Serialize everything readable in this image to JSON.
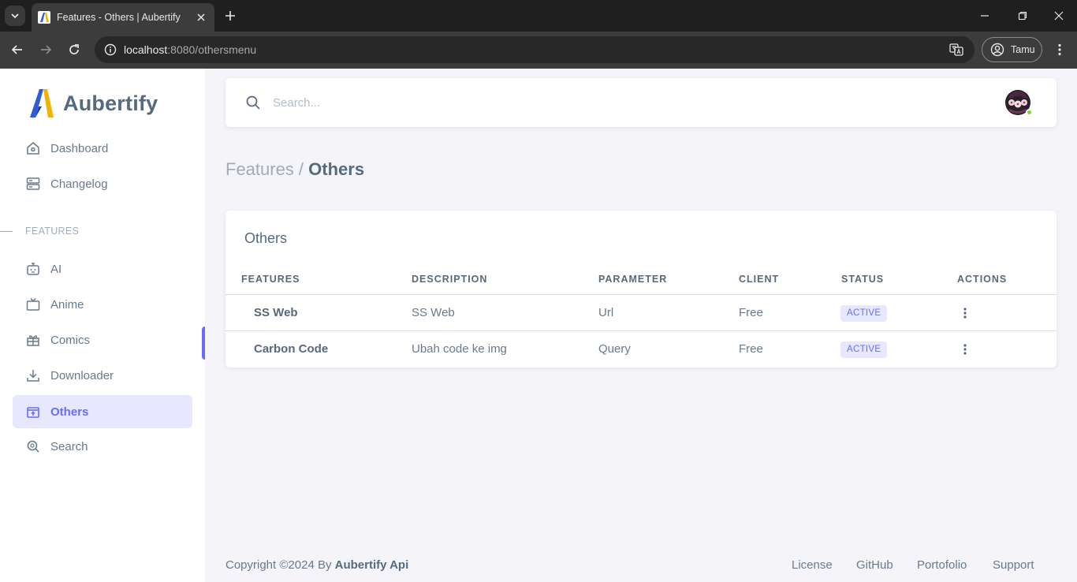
{
  "browser": {
    "tab_title": "Features - Others | Aubertify",
    "url_host": "localhost",
    "url_rest": ":8080/othersmenu",
    "profile_name": "Tamu"
  },
  "sidebar": {
    "brand": "Aubertify",
    "items": [
      {
        "label": "Dashboard",
        "icon": "home-icon"
      },
      {
        "label": "Changelog",
        "icon": "server-icon"
      }
    ],
    "section_header": "FEATURES",
    "feature_items": [
      {
        "label": "AI",
        "icon": "bot-icon"
      },
      {
        "label": "Anime",
        "icon": "tv-icon"
      },
      {
        "label": "Comics",
        "icon": "gift-icon"
      },
      {
        "label": "Downloader",
        "icon": "download-icon"
      },
      {
        "label": "Others",
        "icon": "box-icon",
        "active": true
      },
      {
        "label": "Search",
        "icon": "search-icon"
      }
    ]
  },
  "navbar": {
    "search_placeholder": "Search..."
  },
  "page": {
    "breadcrumb_parent": "Features /",
    "breadcrumb_current": "Others"
  },
  "card": {
    "title": "Others",
    "columns": [
      "FEATURES",
      "DESCRIPTION",
      "PARAMETER",
      "CLIENT",
      "STATUS",
      "ACTIONS"
    ],
    "rows": [
      {
        "feature": "SS Web",
        "description": "SS Web",
        "parameter": "Url",
        "client": "Free",
        "status": "ACTIVE"
      },
      {
        "feature": "Carbon Code",
        "description": "Ubah code ke img",
        "parameter": "Query",
        "client": "Free",
        "status": "ACTIVE"
      }
    ]
  },
  "footer": {
    "copyright": "Copyright ©2024 By",
    "brand": "Aubertify Api",
    "links": [
      "License",
      "GitHub",
      "Portofolio",
      "Support"
    ]
  },
  "colors": {
    "accent": "#696cff",
    "accent_light": "#e7e7ff",
    "text": "#697a8d",
    "heading": "#566a7f",
    "online": "#71dd37"
  }
}
